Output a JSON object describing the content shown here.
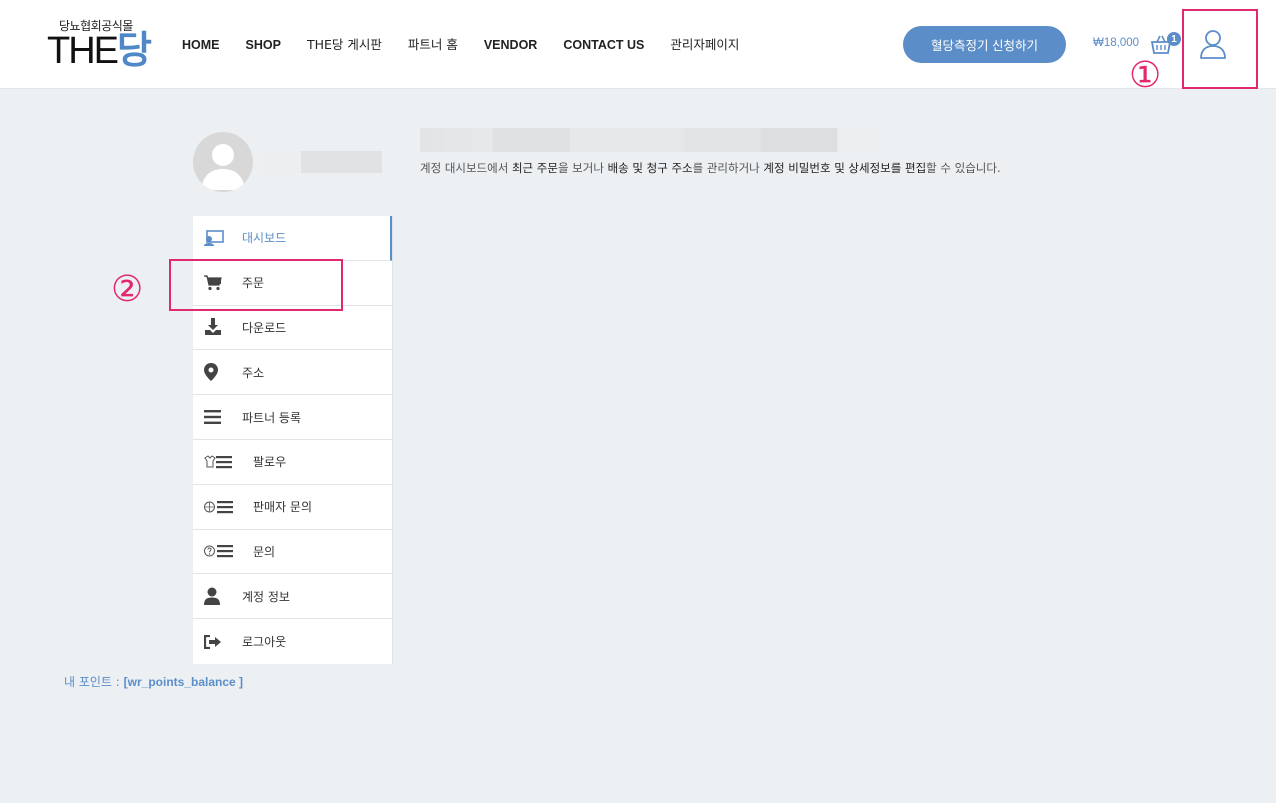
{
  "header": {
    "logo_sub": "당뇨협회공식몰",
    "logo_main_prefix": "THE",
    "logo_main_accent": "당",
    "nav": [
      {
        "label": "HOME"
      },
      {
        "label": "SHOP"
      },
      {
        "label": "THE당 게시판"
      },
      {
        "label": "파트너 홈"
      },
      {
        "label": "VENDOR"
      },
      {
        "label": "CONTACT US"
      },
      {
        "label": "관리자페이지"
      }
    ],
    "cta_label": "혈당측정기 신청하기",
    "cart_total": "₩18,000",
    "cart_count": "1"
  },
  "annotations": {
    "marker_1": "①",
    "marker_2": "②"
  },
  "sidebar": {
    "items": [
      {
        "label": "대시보드",
        "icon": "dashboard-icon"
      },
      {
        "label": "주문",
        "icon": "cart-icon"
      },
      {
        "label": "다운로드",
        "icon": "download-icon"
      },
      {
        "label": "주소",
        "icon": "location-pin-icon"
      },
      {
        "label": "파트너 등록",
        "icon": "menu-lines-icon"
      },
      {
        "label": "팔로우",
        "icon": "follow-list-icon"
      },
      {
        "label": "판매자 문의",
        "icon": "vendor-inquiry-icon"
      },
      {
        "label": "문의",
        "icon": "question-list-icon"
      },
      {
        "label": "계정 정보",
        "icon": "user-icon"
      },
      {
        "label": "로그아웃",
        "icon": "logout-icon"
      }
    ]
  },
  "points": {
    "label": "내 포인트 : ",
    "value": "[wr_points_balance ]"
  },
  "content": {
    "p1": "계정 대시보드에서 ",
    "h1": "최근 주문",
    "p2": "을 보거나 ",
    "h2": "배송 및 청구 주소",
    "p3": "를 관리하거나 ",
    "h3": "계정 비밀번호 및 상세정보를 편집",
    "p4": "할 수 있습니다."
  },
  "colors": {
    "accent": "#5b8dc9",
    "annotation": "#e2296f",
    "background": "#ecf0f3"
  }
}
